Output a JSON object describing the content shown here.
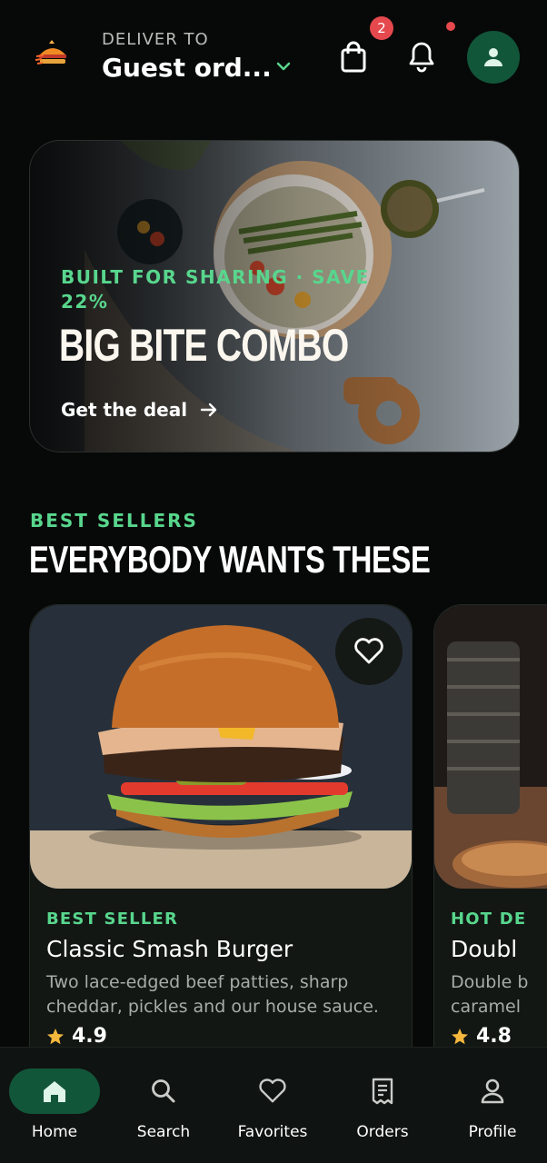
{
  "header": {
    "deliver_label": "DELIVER TO",
    "address": "Guest ord...",
    "cart_count": "2",
    "icons": [
      "logo-icon",
      "chevron-down-icon",
      "shopping-bag-icon",
      "bell-icon",
      "user-icon"
    ]
  },
  "promo": {
    "eyebrow": "BUILT FOR SHARING · SAVE 22%",
    "title": "BIG BITE COMBO",
    "cta": "Get the deal"
  },
  "best_sellers": {
    "eyebrow": "BEST SELLERS",
    "title": "EVERYBODY WANTS THESE",
    "items": [
      {
        "tag": "BEST SELLER",
        "name": "Classic Smash Burger",
        "description": "Two lace-edged beef patties, sharp cheddar, pickles and our house sauce.",
        "rating": "4.9"
      },
      {
        "tag": "HOT DE",
        "name": "Doubl",
        "description": "Double b caramel",
        "rating": "4.8"
      }
    ]
  },
  "nav": {
    "items": [
      {
        "label": "Home",
        "icon": "home-icon",
        "active": true
      },
      {
        "label": "Search",
        "icon": "search-icon",
        "active": false
      },
      {
        "label": "Favorites",
        "icon": "heart-icon",
        "active": false
      },
      {
        "label": "Orders",
        "icon": "receipt-icon",
        "active": false
      },
      {
        "label": "Profile",
        "icon": "user-icon",
        "active": false
      }
    ]
  },
  "colors": {
    "accent": "#58d68d",
    "accent_dark": "#12563a",
    "badge": "#e5484d",
    "background": "#070908",
    "star": "#f5b83d"
  }
}
